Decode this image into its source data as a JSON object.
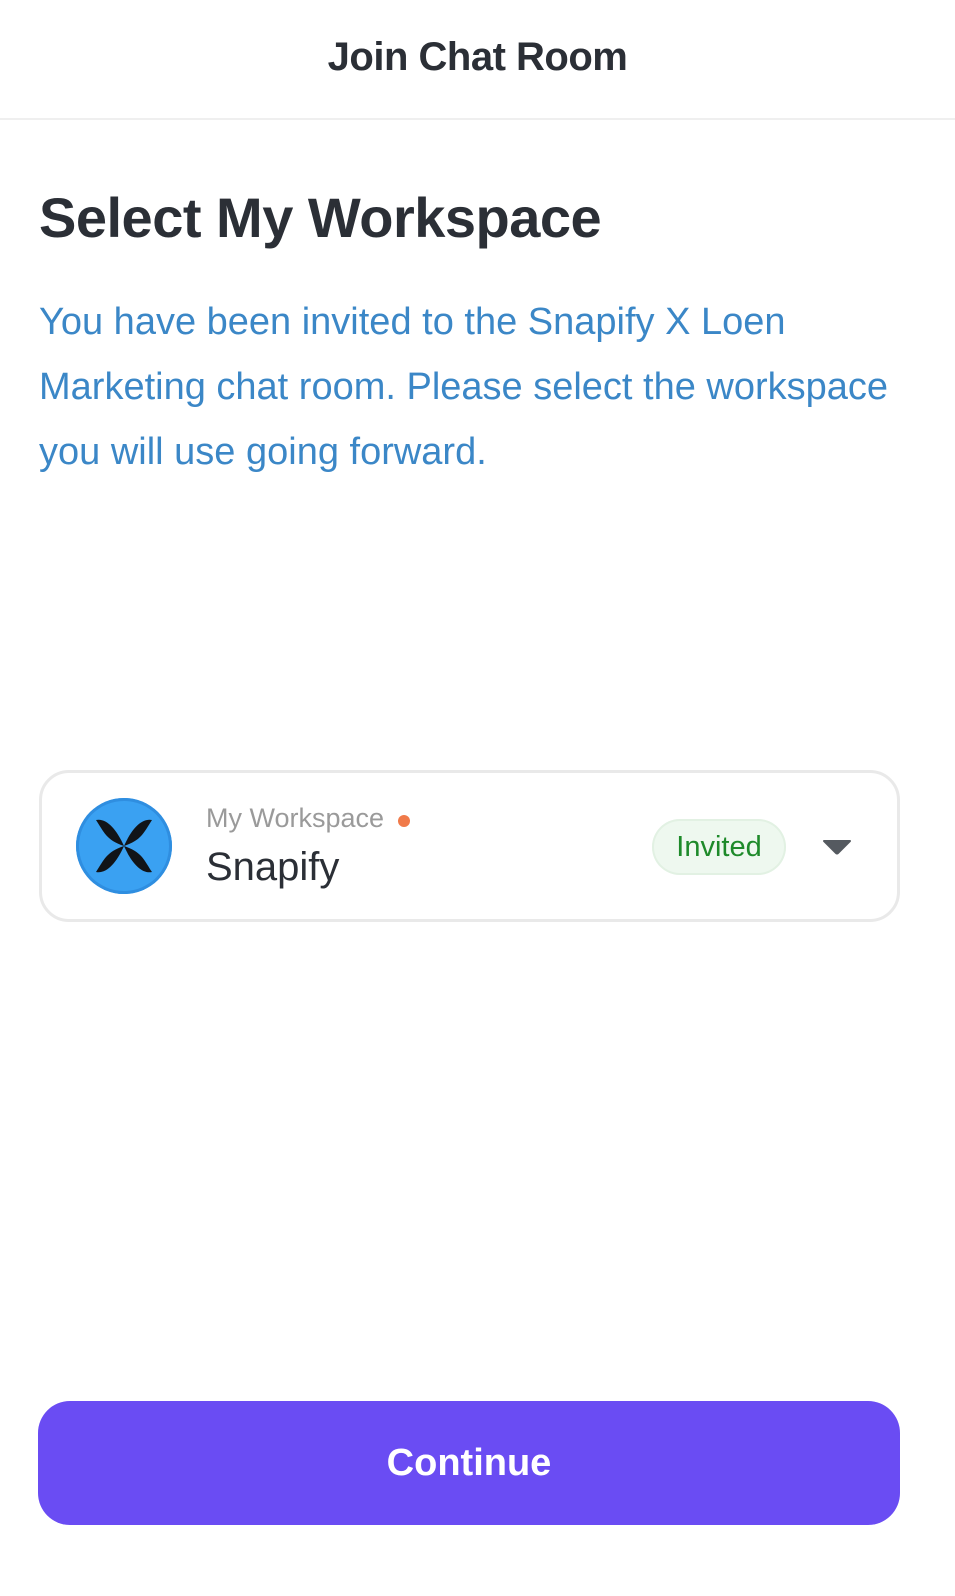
{
  "header": {
    "title": "Join Chat Room"
  },
  "main": {
    "title": "Select My Workspace",
    "description": "You have been invited to the Snapify X Loen Marketing chat room. Please select the workspace you will use going forward."
  },
  "workspace": {
    "label": "My Workspace",
    "name": "Snapify",
    "status": "Invited",
    "avatar_icon": "butterfly-logo-icon",
    "dropdown_icon": "chevron-down-icon"
  },
  "actions": {
    "continue_label": "Continue"
  },
  "colors": {
    "primary": "#6a4cf3",
    "description_text": "#3b87c7",
    "badge_text": "#1e8a2a",
    "badge_bg": "#eef8ef",
    "avatar_bg": "#3aa1f2",
    "label_dot": "#f07a4a"
  }
}
